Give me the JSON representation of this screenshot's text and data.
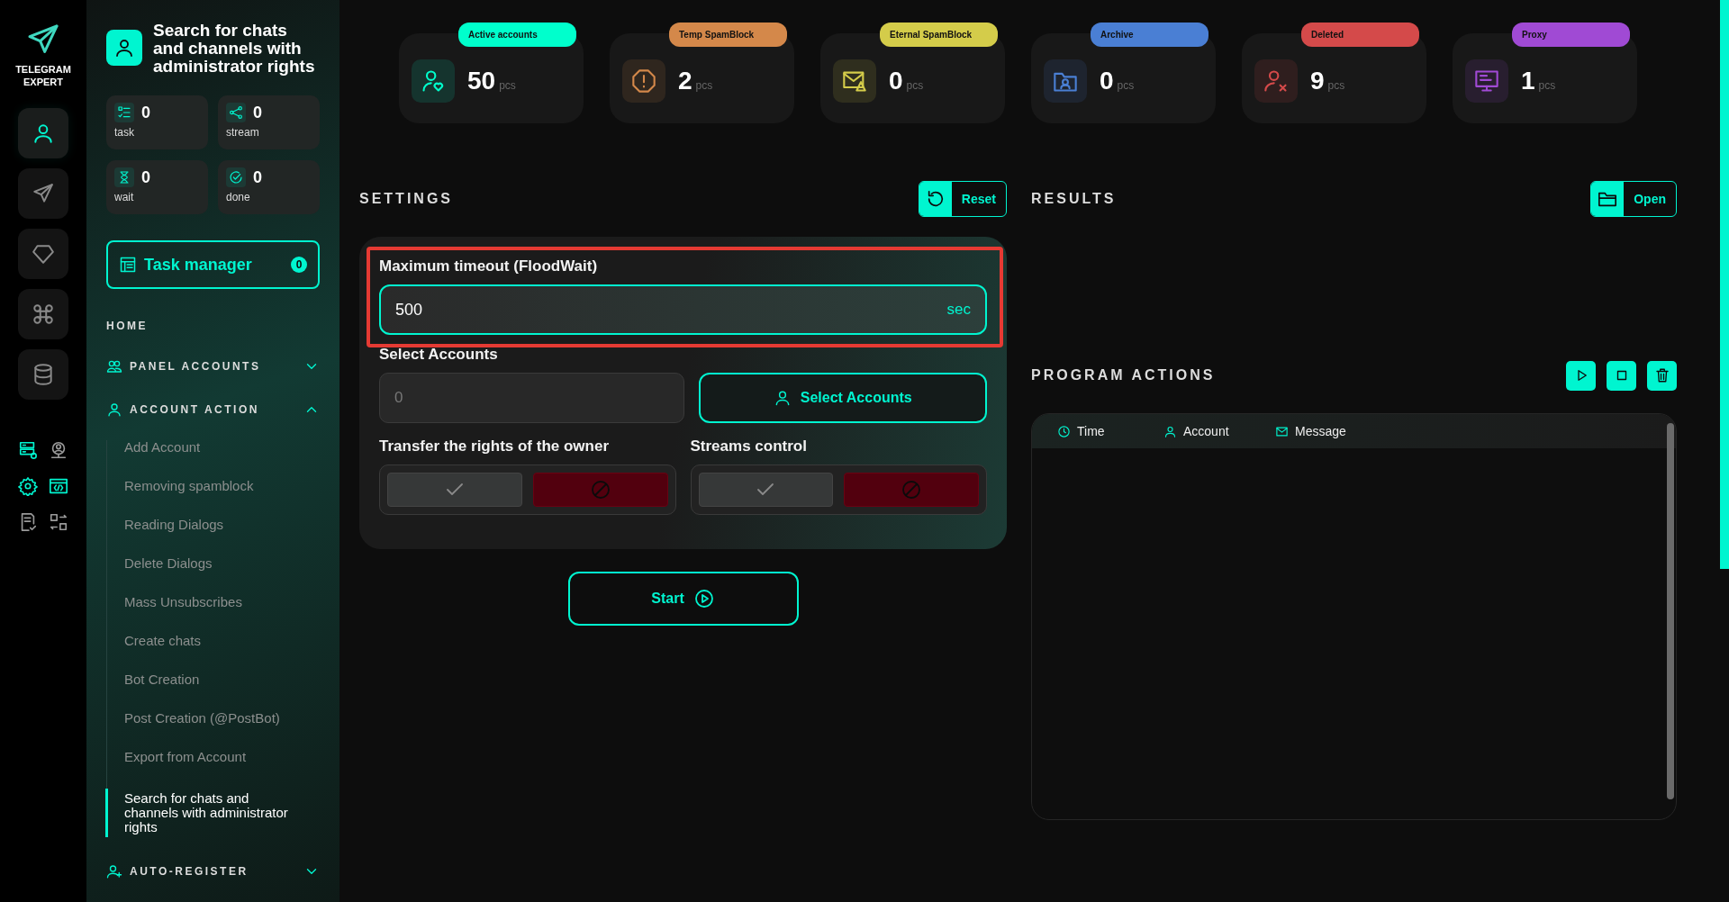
{
  "brand": {
    "name": "TELEGRAM EXPERT"
  },
  "rail_buttons": [
    {
      "selected": true
    },
    {
      "selected": false
    },
    {
      "selected": false
    },
    {
      "selected": false
    },
    {
      "selected": false
    }
  ],
  "rail_tools": [
    {
      "active": true
    },
    {
      "active": false
    },
    {
      "active": true
    },
    {
      "active": true
    },
    {
      "active": false
    },
    {
      "active": false
    }
  ],
  "page_header": {
    "title": "Search for chats and channels with administrator rights"
  },
  "counters": [
    {
      "value": "0",
      "label": "task"
    },
    {
      "value": "0",
      "label": "stream"
    },
    {
      "value": "0",
      "label": "wait"
    },
    {
      "value": "0",
      "label": "done"
    }
  ],
  "task_manager": {
    "label": "Task manager",
    "count": "0"
  },
  "nav": {
    "home": "HOME",
    "sections": [
      {
        "label": "PANEL ACCOUNTS",
        "expanded": false
      },
      {
        "label": "ACCOUNT ACTION",
        "expanded": true,
        "children": [
          {
            "label": "Add Account",
            "selected": false
          },
          {
            "label": "Removing spamblock",
            "selected": false
          },
          {
            "label": "Reading Dialogs",
            "selected": false
          },
          {
            "label": "Delete Dialogs",
            "selected": false
          },
          {
            "label": "Mass Unsubscribes",
            "selected": false
          },
          {
            "label": "Create chats",
            "selected": false
          },
          {
            "label": "Bot Creation",
            "selected": false
          },
          {
            "label": "Post Creation (@PostBot)",
            "selected": false
          },
          {
            "label": "Export from Account",
            "selected": false
          },
          {
            "label": "Search for chats and channels with administrator rights",
            "selected": true
          }
        ]
      },
      {
        "label": "AUTO-REGISTER",
        "expanded": false
      }
    ]
  },
  "stats": [
    {
      "label": "Active accounts",
      "value": "50",
      "unit": "pcs",
      "color": "#00ffcc"
    },
    {
      "label": "Temp SpamBlock",
      "value": "2",
      "unit": "pcs",
      "color": "#d4884a"
    },
    {
      "label": "Eternal SpamBlock",
      "value": "0",
      "unit": "pcs",
      "color": "#d4cc4a"
    },
    {
      "label": "Archive",
      "value": "0",
      "unit": "pcs",
      "color": "#4a7fd4"
    },
    {
      "label": "Deleted",
      "value": "9",
      "unit": "pcs",
      "color": "#d44a4a"
    },
    {
      "label": "Proxy",
      "value": "1",
      "unit": "pcs",
      "color": "#a04ad4"
    }
  ],
  "settings": {
    "title": "SETTINGS",
    "reset_label": "Reset",
    "timeout": {
      "label": "Maximum timeout (FloodWait)",
      "value": "500",
      "unit": "sec",
      "highlighted": true
    },
    "select_accounts": {
      "label": "Select Accounts",
      "placeholder": "0",
      "button": "Select Accounts"
    },
    "toggles": [
      {
        "label": "Transfer the rights of the owner",
        "on": false
      },
      {
        "label": "Streams control",
        "on": false
      }
    ],
    "start_label": "Start"
  },
  "results": {
    "title": "RESULTS",
    "open_label": "Open"
  },
  "program_actions": {
    "title": "PROGRAM ACTIONS",
    "columns": [
      "Time",
      "Account",
      "Message"
    ]
  }
}
